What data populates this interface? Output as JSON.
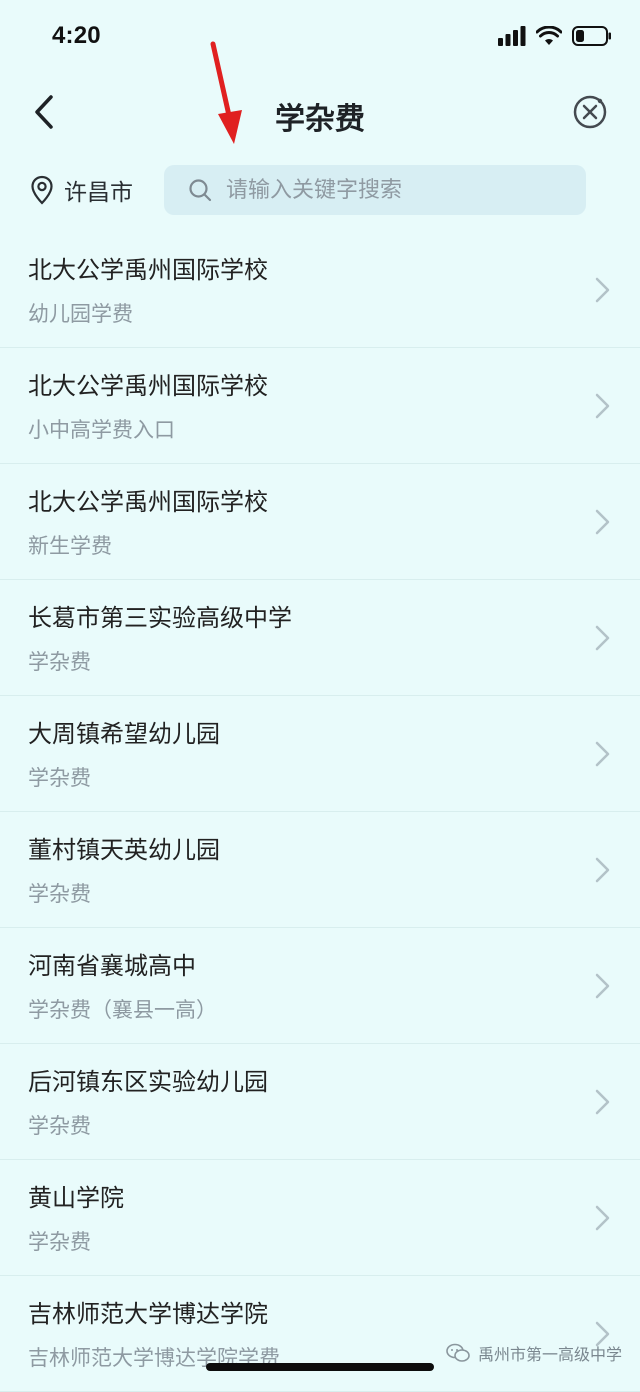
{
  "status_bar": {
    "time": "4:20",
    "icons": [
      "cellular-signal-icon",
      "wifi-icon",
      "battery-icon"
    ],
    "battery_level": 0.25
  },
  "nav": {
    "title": "学杂费",
    "back_icon": "chevron-left-icon",
    "close_icon": "close-circle-icon"
  },
  "location": {
    "icon": "location-pin-icon",
    "city": "许昌市"
  },
  "search": {
    "placeholder": "请输入关键字搜索",
    "value": ""
  },
  "list": {
    "items": [
      {
        "title": "北大公学禹州国际学校",
        "subtitle": "幼儿园学费"
      },
      {
        "title": "北大公学禹州国际学校",
        "subtitle": "小中高学费入口"
      },
      {
        "title": "北大公学禹州国际学校",
        "subtitle": "新生学费"
      },
      {
        "title": "长葛市第三实验高级中学",
        "subtitle": "学杂费"
      },
      {
        "title": "大周镇希望幼儿园",
        "subtitle": "学杂费"
      },
      {
        "title": "董村镇天英幼儿园",
        "subtitle": "学杂费"
      },
      {
        "title": "河南省襄城高中",
        "subtitle": "学杂费（襄县一高）"
      },
      {
        "title": "后河镇东区实验幼儿园",
        "subtitle": "学杂费"
      },
      {
        "title": "黄山学院",
        "subtitle": "学杂费"
      },
      {
        "title": "吉林师范大学博达学院",
        "subtitle": "吉林师范大学博达学院学费"
      }
    ]
  },
  "watermark": {
    "text": "禹州市第一高级中学"
  },
  "colors": {
    "background": "#e9fbfb",
    "search_bg": "#d7eef3",
    "subtitle": "#8e9aa2",
    "annotation_arrow": "#e02020"
  }
}
